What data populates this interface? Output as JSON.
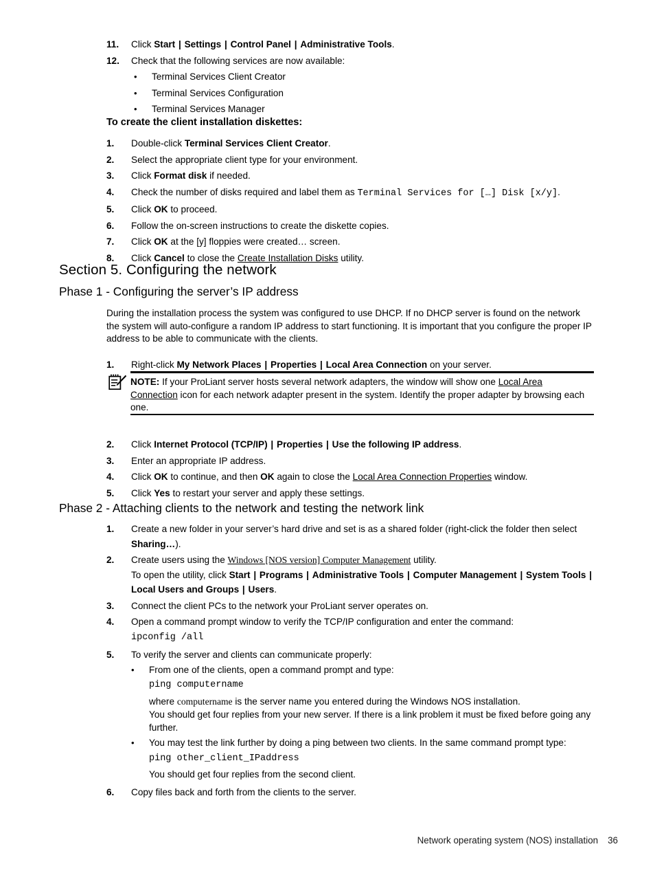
{
  "document": {
    "footer_text": "Network operating system (NOS) installation",
    "page_number": "36"
  },
  "block_12": {
    "item11": {
      "num": "11.",
      "lead": "Click ",
      "b1": "Start",
      "s1": "|",
      "b2": "Settings",
      "s2": "|",
      "b3": "Control Panel",
      "s3": "|",
      "b4": "Administrative Tools",
      "tail": "."
    },
    "item12": {
      "num": "12.",
      "text": "Check that the following services are now available:"
    },
    "bullets": [
      {
        "mark": "•",
        "text": "Terminal Services Client Creator"
      },
      {
        "mark": "•",
        "text": "Terminal Services Configuration"
      },
      {
        "mark": "•",
        "text": "Terminal Services Manager"
      }
    ]
  },
  "diskettes_heading": "To create the client installation diskettes:",
  "diskettes": {
    "i1": {
      "num": "1.",
      "lead": "Double-click ",
      "bold": "Terminal Services Client Creator",
      "tail": "."
    },
    "i2": {
      "num": "2.",
      "text": "Select the appropriate client type for your environment."
    },
    "i3": {
      "num": "3.",
      "lead": "Click ",
      "bold": "Format disk",
      "tail": " if needed."
    },
    "i4": {
      "num": "4.",
      "lead": "Check the number of disks required and label them as ",
      "mono": "Terminal Services for […] Disk [x/y]",
      "tail": "."
    },
    "i5": {
      "num": "5.",
      "lead": "Click ",
      "bold": "OK",
      "tail": " to proceed."
    },
    "i6": {
      "num": "6.",
      "text": "Follow the on-screen instructions to create the diskette copies."
    },
    "i7": {
      "num": "7.",
      "lead": "Click ",
      "bold": "OK",
      "tail": " at the [y] floppies were created… screen."
    },
    "i8": {
      "num": "8.",
      "lead": "Click ",
      "bold": "Cancel",
      "mid": " to close the ",
      "underline": "Create Installation Disks",
      "tail": " utility."
    }
  },
  "section5_title": "Section 5. Configuring the network",
  "phase1": {
    "title": "Phase 1 - Configuring the server’s IP address",
    "paragraph": "During the installation process the system was configured to use DHCP. If no DHCP server is found on the network the system will auto-configure a random IP address to start functioning. It is important that you configure the proper IP address to be able to communicate with the clients.",
    "i1": {
      "num": "1.",
      "lead": "Right-click ",
      "b1": "My Network Places",
      "s1": "|",
      "b2": "Properties",
      "s2": "|",
      "b3": "Local Area Connection",
      "tail": " on your server."
    },
    "i2": {
      "num": "2.",
      "lead": "Click ",
      "b1": "Internet Protocol (TCP/IP)",
      "s1": "|",
      "b2": "Properties",
      "s2": "|",
      "b3": "Use the following IP address",
      "tail": "."
    },
    "i3": {
      "num": "3.",
      "text": "Enter an appropriate IP address."
    },
    "i4": {
      "num": "4.",
      "lead": "Click ",
      "b1": "OK",
      "mid1": " to continue, and then ",
      "b2": "OK",
      "mid2": " again to close the ",
      "underline": "Local Area Connection Properties",
      "tail": " window."
    },
    "i5": {
      "num": "5.",
      "lead": "Click ",
      "bold": "Yes",
      "tail": " to restart your server and apply these settings."
    }
  },
  "note": {
    "icon": "note-pencil-icon",
    "label": "NOTE:",
    "part1": " If your ProLiant server hosts several network adapters, the window will show one ",
    "underline1": "Local Area Connection",
    "part2": " icon for each network adapter present in the system. Identify the proper adapter by browsing each one."
  },
  "phase2": {
    "title": "Phase 2 - Attaching clients to the network and testing the network link",
    "i1": {
      "num": "1.",
      "lead": "Create a new folder in your server’s hard drive and set is as a shared folder (right-click the folder then select ",
      "bold": "Sharing…",
      "tail": ")."
    },
    "i2": {
      "num": "2.",
      "lead": "Create users using the ",
      "underline": "Windows [NOS version] Computer Management",
      "tail": " utility."
    },
    "i2sub": {
      "lead": "To open the utility, click ",
      "b1": "Start",
      "s1": "|",
      "b2": "Programs",
      "s2": "|",
      "b3": "Administrative Tools",
      "s3": "|",
      "b4": "Computer Management",
      "s4": "|",
      "b5": "System Tools",
      "s5": "|",
      "b6": "Local Users and Groups",
      "s6": "|",
      "b7": "Users",
      "tail": "."
    },
    "i3": {
      "num": "3.",
      "text": "Connect the client PCs to the network your ProLiant server operates on."
    },
    "i4": {
      "num": "4.",
      "text": "Open a command prompt window to verify the TCP/IP configuration and enter the command:",
      "command": "ipconfig /all"
    },
    "i5": {
      "num": "5.",
      "text": "To verify the server and clients can communicate properly:"
    },
    "i5b1": {
      "mark": "•",
      "text": "From one of the clients, open a command prompt and type:",
      "command": "ping computername",
      "note_lead": "where ",
      "note_serif": "computername",
      "note_tail": " is the server name you entered during the Windows NOS installation.",
      "note2": "You should get four replies from your new server. If there is a link problem it must be fixed before going any further."
    },
    "i5b2": {
      "mark": "•",
      "text": "You may test the link further by doing a ping between two clients. In the same command prompt type:",
      "command": "ping other_client_IPaddress",
      "note": "You should get four replies from the second client."
    },
    "i6": {
      "num": "6.",
      "text": "Copy files back and forth from the clients to the server."
    }
  }
}
